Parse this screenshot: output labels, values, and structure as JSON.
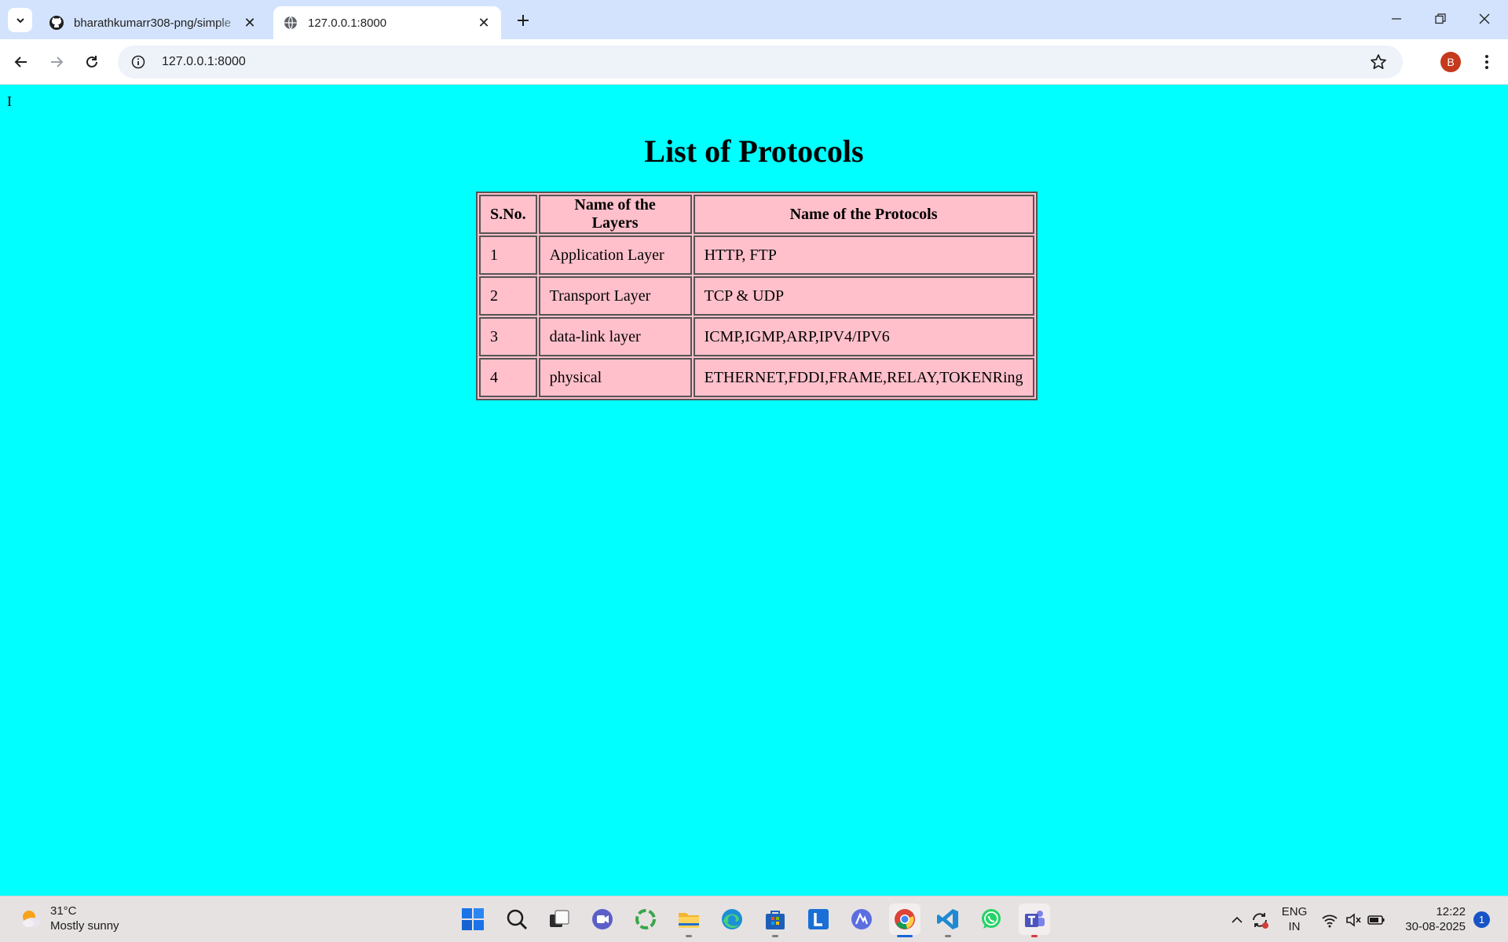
{
  "browser": {
    "tabs": [
      {
        "title": "bharathkumarr308-png/simple",
        "favicon": "github-icon",
        "active": false
      },
      {
        "title": "127.0.0.1:8000",
        "favicon": "globe-icon",
        "active": true
      }
    ],
    "url": "127.0.0.1:8000",
    "profile_initial": "B",
    "colors": {
      "tabstrip": "#d3e3fd",
      "omnibox": "#eef2f9",
      "profile": "#c5391c"
    }
  },
  "page": {
    "cursor_text": "I",
    "title": "List of Protocols",
    "background": "#00ffff",
    "table_background": "#ffc0cb",
    "table": {
      "headers": [
        "S.No.",
        "Name of the Layers",
        "Name of the Protocols"
      ],
      "rows": [
        [
          "1",
          "Application Layer",
          "HTTP, FTP"
        ],
        [
          "2",
          "Transport Layer",
          "TCP & UDP"
        ],
        [
          "3",
          "data-link layer",
          "ICMP,IGMP,ARP,IPV4/IPV6"
        ],
        [
          "4",
          "physical",
          "ETHERNET,FDDI,FRAME,RELAY,TOKENRing"
        ]
      ]
    }
  },
  "taskbar": {
    "weather": {
      "temp": "31°C",
      "condition": "Mostly sunny",
      "icon": "partly-sunny-icon"
    },
    "apps": [
      "windows-start-icon",
      "search-icon",
      "task-view-icon",
      "meet-icon",
      "copilot-icon",
      "file-explorer-icon",
      "edge-icon",
      "microsoft-store-icon",
      "l-app-icon",
      "ai-app-icon",
      "chrome-icon",
      "vscode-icon",
      "whatsapp-icon",
      "teams-icon"
    ],
    "language": {
      "line1": "ENG",
      "line2": "IN"
    },
    "time": "12:22",
    "date": "30-08-2025",
    "notification_count": "1"
  }
}
